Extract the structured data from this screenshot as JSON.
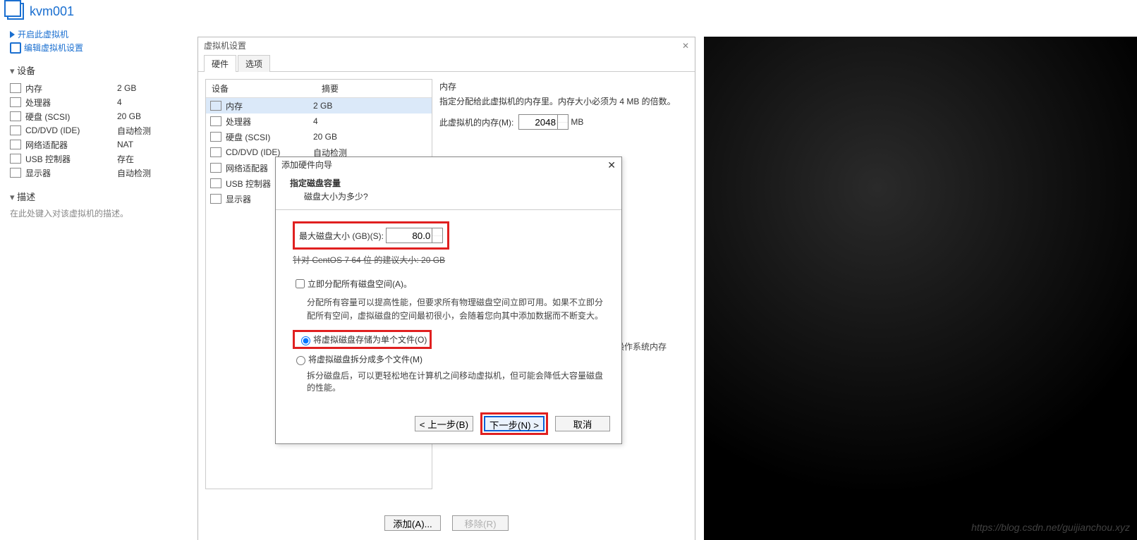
{
  "title": {
    "vmname": "kvm001"
  },
  "links": {
    "power": "开启此虚拟机",
    "edit": "编辑虚拟机设置"
  },
  "sections": {
    "devices": "设备",
    "desc": "描述"
  },
  "side_devices": [
    {
      "k": "内存",
      "v": "2 GB"
    },
    {
      "k": "处理器",
      "v": "4"
    },
    {
      "k": "硬盘 (SCSI)",
      "v": "20 GB"
    },
    {
      "k": "CD/DVD (IDE)",
      "v": "自动检测"
    },
    {
      "k": "网络适配器",
      "v": "NAT"
    },
    {
      "k": "USB 控制器",
      "v": "存在"
    },
    {
      "k": "显示器",
      "v": "自动检测"
    }
  ],
  "desc_hint": "在此处键入对该虚拟机的描述。",
  "settings": {
    "title": "虚拟机设置",
    "tab_hw": "硬件",
    "tab_opt": "选项",
    "col_dev": "设备",
    "col_sum": "摘要",
    "rows": [
      {
        "k": "内存",
        "v": "2 GB"
      },
      {
        "k": "处理器",
        "v": "4"
      },
      {
        "k": "硬盘 (SCSI)",
        "v": "20 GB"
      },
      {
        "k": "CD/DVD (IDE)",
        "v": "自动检测"
      },
      {
        "k": "网络适配器",
        "v": ""
      },
      {
        "k": "USB 控制器",
        "v": ""
      },
      {
        "k": "显示器",
        "v": ""
      }
    ],
    "mem_title": "内存",
    "mem_text": "指定分配给此虚拟机的内存里。内存大小必须为 4 MB 的倍数。",
    "mem_label": "此虚拟机的内存(M):",
    "mem_value": "2048",
    "mem_unit": "MB",
    "os_note": "操作系统内存",
    "add": "添加(A)...",
    "remove": "移除(R)"
  },
  "wizard": {
    "title": "添加硬件向导",
    "h1": "指定磁盘容量",
    "h2": "磁盘大小为多少?",
    "size_label": "最大磁盘大小 (GB)(S):",
    "size_value": "80.0",
    "recommend": "针对 CentOS 7 64 位 的建议大小: 20 GB",
    "alloc_now": "立即分配所有磁盘空间(A)。",
    "alloc_expl": "分配所有容量可以提高性能，但要求所有物理磁盘空间立即可用。如果不立即分配所有空间，虚拟磁盘的空间最初很小，会随着您向其中添加数据而不断变大。",
    "radio_single": "将虚拟磁盘存储为单个文件(O)",
    "radio_multi": "将虚拟磁盘拆分成多个文件(M)",
    "multi_expl": "拆分磁盘后，可以更轻松地在计算机之间移动虚拟机，但可能会降低大容量磁盘的性能。",
    "back": "< 上一步(B)",
    "next": "下一步(N) >",
    "cancel": "取消"
  },
  "watermark": "https://blog.csdn.net/guijianchou.xyz"
}
